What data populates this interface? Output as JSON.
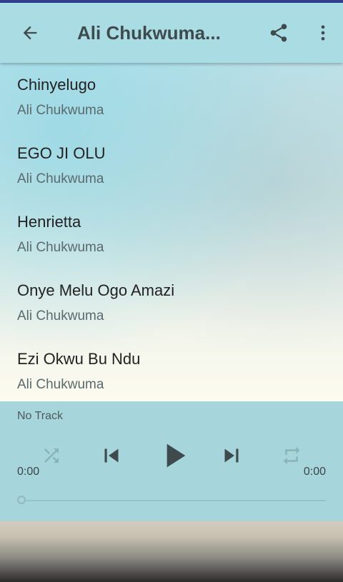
{
  "app_bar": {
    "title": "Ali Chukwuma..."
  },
  "tracks": [
    {
      "title": "Chinyelugo",
      "artist": "Ali Chukwuma"
    },
    {
      "title": "EGO JI OLU",
      "artist": "Ali Chukwuma"
    },
    {
      "title": "Henrietta",
      "artist": "Ali Chukwuma"
    },
    {
      "title": "Onye Melu Ogo Amazi",
      "artist": "Ali Chukwuma"
    },
    {
      "title": "Ezi Okwu Bu Ndu",
      "artist": "Ali Chukwuma"
    }
  ],
  "player": {
    "now_playing": "No Track",
    "elapsed": "0:00",
    "duration": "0:00",
    "progress": 0
  },
  "icons": {
    "back": "arrow-back-icon",
    "share": "share-icon",
    "more": "more-vert-icon",
    "shuffle": "shuffle-icon",
    "previous": "skip-previous-icon",
    "play": "play-icon",
    "next": "skip-next-icon",
    "repeat": "repeat-icon"
  },
  "colors": {
    "app_bar": "#a9dde3",
    "player_bar": "#a6d5dc",
    "icon_dark": "#3f4a4d",
    "icon_muted": "#8ab3b8"
  }
}
